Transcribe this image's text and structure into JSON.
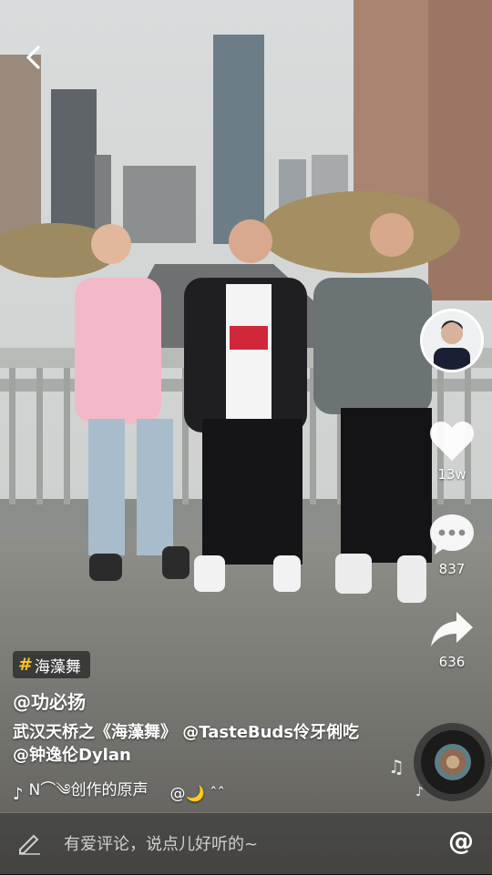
{
  "hashtag": {
    "symbol": "#",
    "label": "海藻舞"
  },
  "author": {
    "handle": "@功必扬"
  },
  "caption": {
    "text": "武汉天桥之《海藻舞》 @TasteBuds伶牙俐吃 @钟逸伦Dylan"
  },
  "music": {
    "label": "N⌒༄创作的原声",
    "mention": "@🌙 ˆˆ"
  },
  "stats": {
    "likes": "13w",
    "comments": "837",
    "shares": "636"
  },
  "comment_bar": {
    "placeholder": "有爱评论，说点儿好听的~",
    "at_symbol": "@"
  },
  "icons": {
    "back": "chevron-left-icon",
    "like": "heart-icon",
    "comment": "speech-bubble-icon",
    "share": "share-arrow-icon",
    "music": "music-note-icon",
    "pen": "pen-icon"
  }
}
